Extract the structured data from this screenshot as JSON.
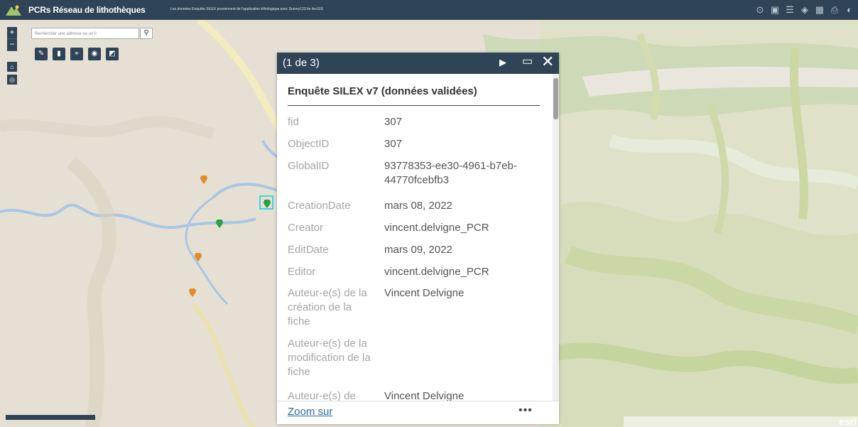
{
  "header": {
    "title": "PCRs Réseau de lithothèques",
    "subtitle": "Les données Enquête SILEX proviennent de l'application éthologique avec Survey123 for ArcGIS"
  },
  "search": {
    "placeholder": "Rechercher une adresse ou un li"
  },
  "popup": {
    "count": "(1 de 3)",
    "title": "Enquête SILEX v7 (données validées)",
    "attributes": [
      {
        "label": "fid",
        "value": "307"
      },
      {
        "label": "ObjectID",
        "value": "307"
      },
      {
        "label": "GlobalID",
        "value": "93778353-ee30-4961-b7eb-44770fcebfb3"
      },
      {
        "label": "CreationDate",
        "value": "mars 08, 2022"
      },
      {
        "label": "Creator",
        "value": "vincent.delvigne_PCR"
      },
      {
        "label": "EditDate",
        "value": "mars 09, 2022"
      },
      {
        "label": "Editor",
        "value": "vincent.delvigne_PCR"
      },
      {
        "label": "Auteur-e(s) de la création de la fiche",
        "value": "Vincent Delvigne"
      },
      {
        "label": "Auteur-e(s) de la modification de la fiche",
        "value": ""
      },
      {
        "label": "Auteur-e(s) de",
        "value": "Vincent Delvigne"
      }
    ],
    "zoom_label": "Zoom sur",
    "more_label": "•••"
  },
  "attribution": {
    "esri": "esri"
  },
  "colors": {
    "header_bg": "#2f4456",
    "marker_orange": "#e38b2a",
    "marker_green": "#2f9e44",
    "link": "#2b6aa4"
  }
}
